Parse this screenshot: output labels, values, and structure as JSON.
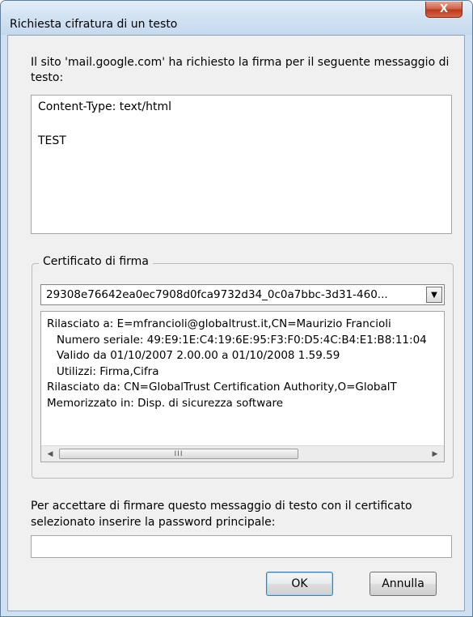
{
  "window": {
    "title": "Richiesta cifratura di un testo",
    "close_glyph": "X"
  },
  "intro_label": "Il sito 'mail.google.com' ha richiesto la firma per il seguente messaggio di testo:",
  "message_text": "Content-Type: text/html\n\nTEST",
  "certificate": {
    "group_label": "Certificato di firma",
    "selected": "29308e76642ea0ec7908d0fca9732d34_0c0a7bbc-3d31-460...",
    "details": [
      "Rilasciato a: E=mfrancioli@globaltrust.it,CN=Maurizio Francioli",
      "Numero seriale: 49:E9:1E:C4:19:6E:95:F3:F0:D5:4C:B4:E1:B8:11:04",
      "Valido da 01/10/2007 2.00.00 a 01/10/2008 1.59.59",
      "Utilizzi: Firma,Cifra",
      "Rilasciato da: CN=GlobalTrust Certification Authority,O=GlobalT",
      "Memorizzato in: Disp. di sicurezza software"
    ],
    "scroll_grip": "III"
  },
  "confirm_label": "Per accettare di firmare questo messaggio di testo con il certificato selezionato inserire la password principale:",
  "password_value": "",
  "buttons": {
    "ok": "OK",
    "cancel": "Annulla"
  }
}
